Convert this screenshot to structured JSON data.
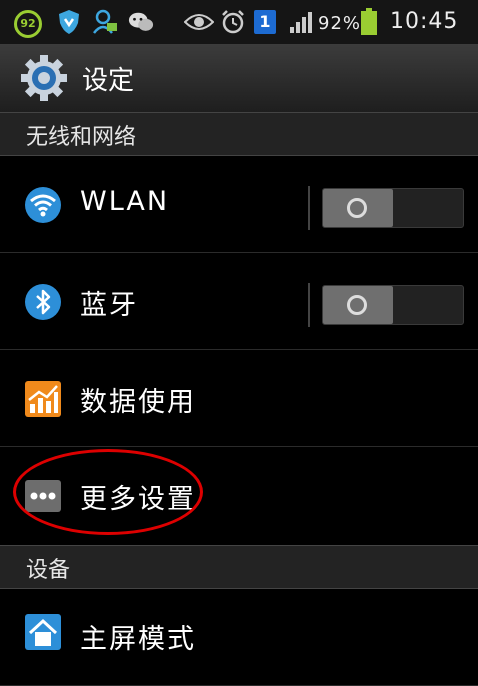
{
  "status_bar": {
    "notification_count": "92",
    "battery_percent": "92%",
    "sim_badge": "1",
    "time": "10:45",
    "icons": [
      "notification-count-icon",
      "shield-icon",
      "contact-notification-icon",
      "wechat-icon",
      "eye-icon",
      "alarm-clock-icon",
      "sim-badge-icon",
      "signal-icon",
      "battery-icon"
    ]
  },
  "action_bar": {
    "title": "设定",
    "icon": "settings-gear-icon"
  },
  "sections": [
    {
      "header": "无线和网络"
    },
    {
      "header": "设备"
    }
  ],
  "items": [
    {
      "label": "WLAN",
      "icon": "wifi-icon",
      "toggle": "off"
    },
    {
      "label": "蓝牙",
      "icon": "bluetooth-icon",
      "toggle": "off"
    },
    {
      "label": "数据使用",
      "icon": "data-usage-icon"
    },
    {
      "label": "更多设置",
      "icon": "more-icon"
    },
    {
      "label": "主屏模式",
      "icon": "home-icon"
    }
  ],
  "colors": {
    "accent": "#33b5e5",
    "highlight": "#dd0000",
    "battery": "#9acd32"
  }
}
